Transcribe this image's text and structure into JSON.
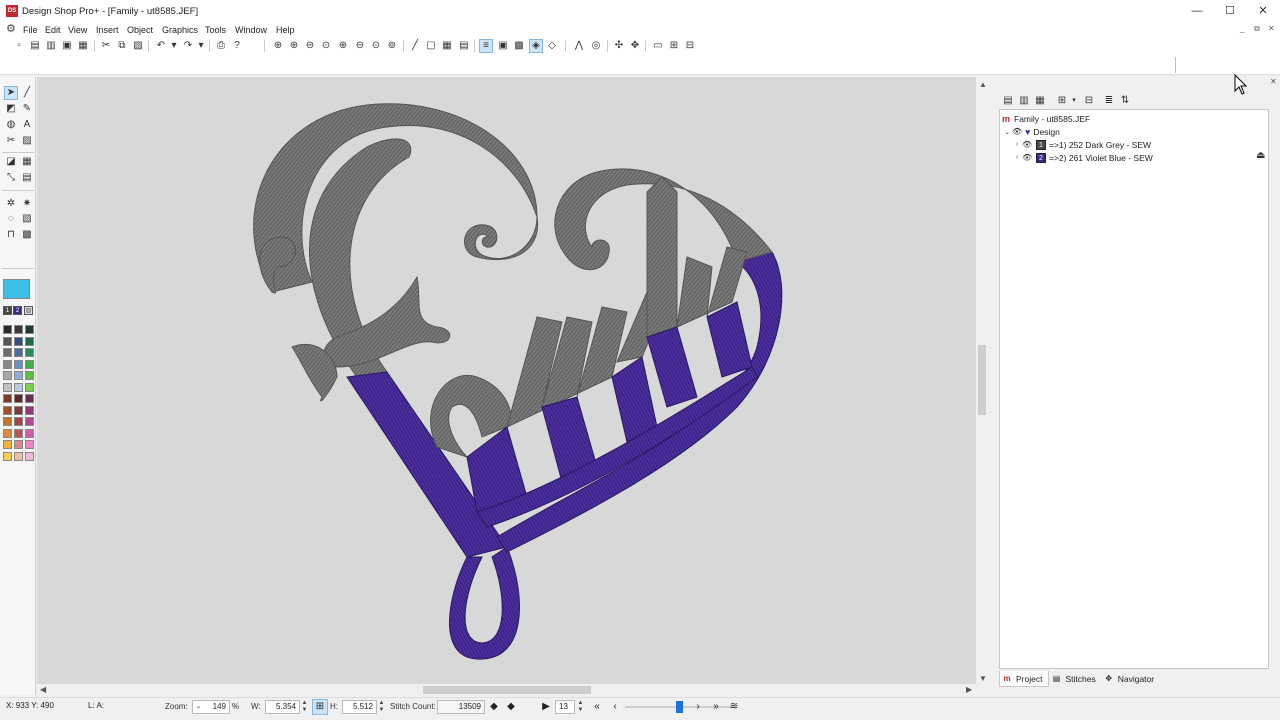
{
  "window": {
    "title": "Design Shop Pro+ - [Family - ut8585.JEF]",
    "logo_text": "DS",
    "minimize": "—",
    "maximize": "☐",
    "close": "✕"
  },
  "menu": {
    "items": [
      "File",
      "Edit",
      "View",
      "Insert",
      "Object",
      "Graphics",
      "Tools",
      "Window",
      "Help"
    ],
    "mdi_minimize": "_",
    "mdi_restore": "⧉",
    "mdi_close": "✕"
  },
  "panel": {
    "close": "✕",
    "tree": {
      "root": "Family - ut8585.JEF",
      "group": "Design",
      "items": [
        {
          "label": "=>1) 252 Dark Grey - SEW",
          "number": "1",
          "color": "#4a4a4a"
        },
        {
          "label": "=>2) 261 Violet Blue - SEW",
          "number": "2",
          "color": "#3a2a8a"
        }
      ]
    },
    "tabs": [
      "Project",
      "Stitches",
      "Navigator"
    ]
  },
  "palette": {
    "current_color": "#3bbfe9",
    "thread_chips": [
      "1",
      "2"
    ],
    "swatches": [
      "#2b2b2b",
      "#3a3a3a",
      "#1d3a2c",
      "#555555",
      "#2f4f7f",
      "#1c6a44",
      "#6d6d6d",
      "#4a6fa5",
      "#2e8b57",
      "#8a8a8a",
      "#6a8fc2",
      "#3fae49",
      "#a8a8a8",
      "#8fb0d9",
      "#5cc243",
      "#c2c2c2",
      "#b5cbe6",
      "#7ad24b",
      "#7b3a2a",
      "#5a2a2a",
      "#6b2e5a",
      "#a0522d",
      "#7a3b3b",
      "#8b3a7a",
      "#c8742f",
      "#a04444",
      "#b04a90",
      "#e08a3c",
      "#c05555",
      "#d060a8",
      "#f0b040",
      "#d88a8a",
      "#e88ac0",
      "#f6d050",
      "#efc0a0",
      "#f4b8d4"
    ]
  },
  "status": {
    "coords": "X: 933   Y: 490",
    "layer": "L: A:",
    "zoom_label": "Zoom:",
    "zoom_value": "149",
    "zoom_unit": "%",
    "w_label": "W:",
    "w_value": "5.354",
    "h_label": "H:",
    "h_value": "5.512",
    "stitch_label": "Stitch Count:",
    "stitch_value": "13509",
    "step_value": "13"
  },
  "design": {
    "grey_color": "#737373",
    "violet_color": "#4b2fa0"
  }
}
